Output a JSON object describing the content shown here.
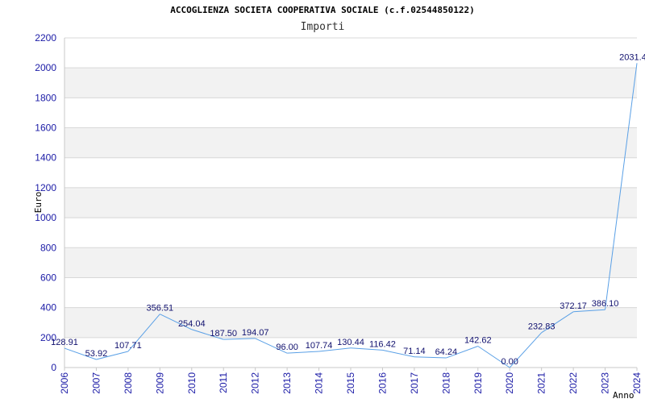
{
  "chart_data": {
    "type": "line",
    "title": "ACCOGLIENZA SOCIETA COOPERATIVA SOCIALE (c.f.02544850122)",
    "subtitle": "Importi",
    "xlabel": "Anno",
    "ylabel": "Euro",
    "ylim": [
      0,
      2200
    ],
    "yticks": [
      0,
      200,
      400,
      600,
      800,
      1000,
      1200,
      1400,
      1600,
      1800,
      2000,
      2200
    ],
    "grid": true,
    "categories": [
      "2006",
      "2007",
      "2008",
      "2009",
      "2010",
      "2011",
      "2012",
      "2013",
      "2014",
      "2015",
      "2016",
      "2017",
      "2018",
      "2019",
      "2020",
      "2021",
      "2022",
      "2023",
      "2024"
    ],
    "series": [
      {
        "values": [
          128.91,
          53.92,
          107.71,
          356.51,
          254.04,
          187.5,
          194.07,
          96.0,
          107.74,
          130.44,
          116.42,
          71.14,
          64.24,
          142.62,
          0.0,
          232.83,
          372.17,
          386.1,
          2031.4
        ],
        "labels": [
          "128.91",
          "53.92",
          "107.71",
          "356.51",
          "254.04",
          "187.50",
          "194.07",
          "96.00",
          "107.74",
          "130.44",
          "116.42",
          "71.14",
          "64.24",
          "142.62",
          "0.00",
          "232.83",
          "372.17",
          "386.10",
          "2031.4"
        ]
      }
    ],
    "colors": {
      "line": "#5aa0e6",
      "band": "#f2f2f2",
      "grid": "#d8d8d8",
      "tick_text": "#1a1aa6",
      "label_text": "#10106e"
    }
  }
}
